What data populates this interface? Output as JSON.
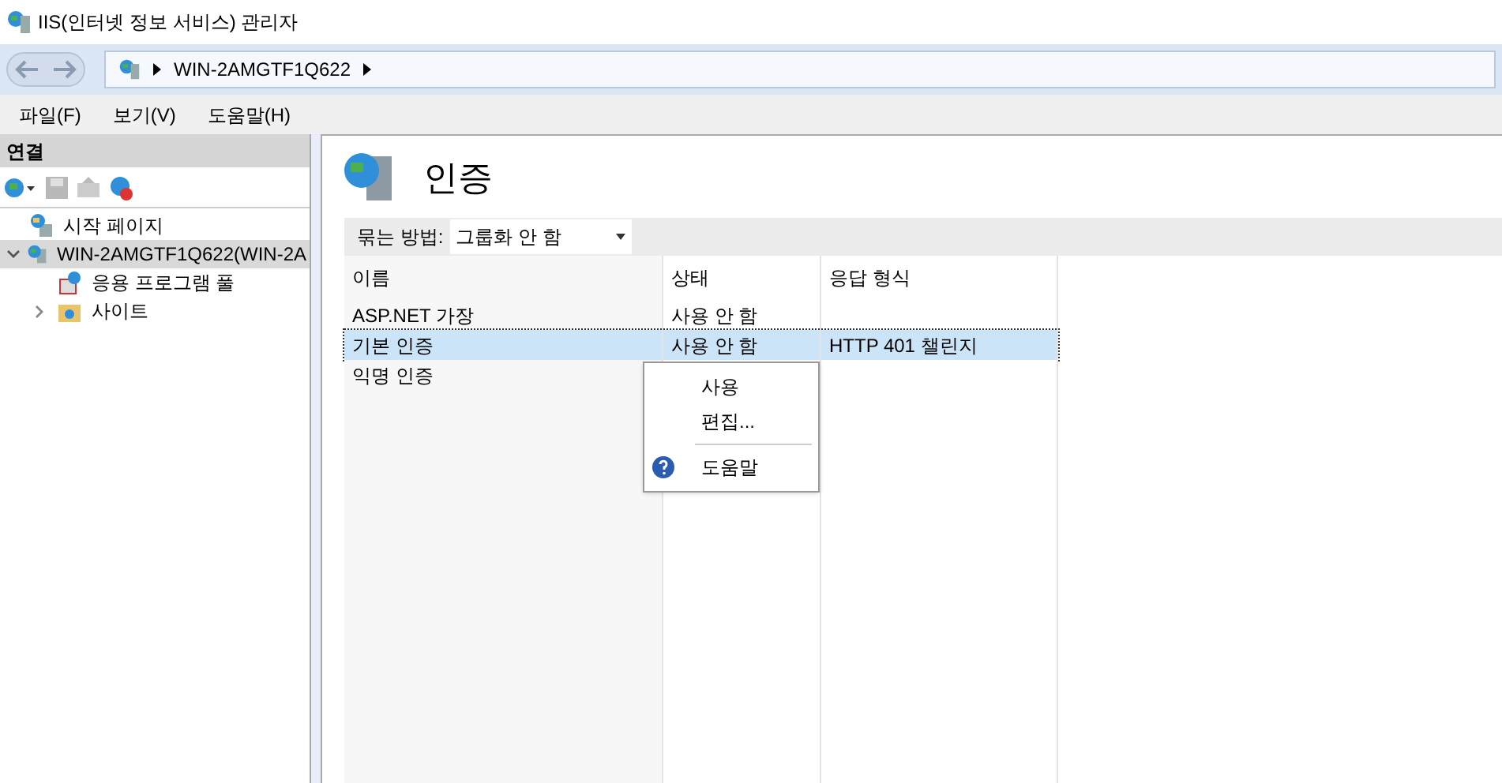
{
  "window": {
    "title": "IIS(인터넷 정보 서비스) 관리자"
  },
  "address": {
    "crumbs": [
      "WIN-2AMGTF1Q622"
    ]
  },
  "menu": [
    "파일(F)",
    "보기(V)",
    "도움말(H)"
  ],
  "connections": {
    "title": "연결",
    "tree": [
      {
        "label": "시작 페이지",
        "kind": "start",
        "selected": false
      },
      {
        "label": "WIN-2AMGTF1Q622(WIN-2A",
        "kind": "server",
        "selected": true,
        "expanded": true,
        "children": [
          {
            "label": "응용 프로그램 풀",
            "kind": "pool",
            "selected": false
          },
          {
            "label": "사이트",
            "kind": "sites",
            "selected": false,
            "expanded": false
          }
        ]
      }
    ]
  },
  "page": {
    "heading": "인증",
    "group_by": {
      "label": "묶는 방법:",
      "value": "그룹화 안 함"
    },
    "table": {
      "columns": [
        "이름",
        "상태",
        "응답 형식"
      ],
      "rows": [
        {
          "cells": [
            "ASP.NET 가장",
            "사용 안 함",
            ""
          ],
          "selected": false
        },
        {
          "cells": [
            "기본 인증",
            "사용 안 함",
            "HTTP 401 챌린지"
          ],
          "selected": true
        },
        {
          "cells": [
            "익명 인증",
            "",
            ""
          ],
          "selected": false
        }
      ]
    }
  },
  "context_menu": [
    {
      "kind": "item",
      "label": "사용"
    },
    {
      "kind": "item",
      "label": "편집..."
    },
    {
      "kind": "separator"
    },
    {
      "kind": "help",
      "label": "도움말"
    }
  ]
}
